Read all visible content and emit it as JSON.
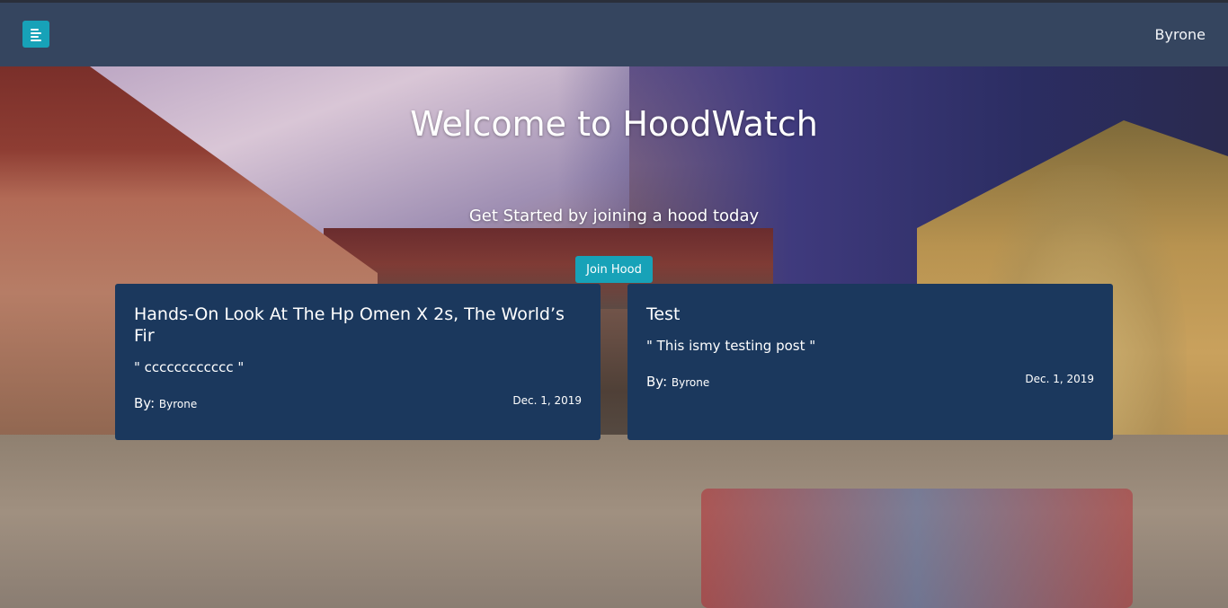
{
  "navbar": {
    "menu_icon": "menu-lines-icon",
    "user_name": "Byrone"
  },
  "hero": {
    "title": "Welcome to HoodWatch",
    "subtitle": "Get Started by joining a hood today",
    "join_button_label": "Join Hood"
  },
  "posts": [
    {
      "title": "Hands-On Look At The Hp Omen X 2s, The World’s Fir",
      "body": "\" cccccccccccc \"",
      "by_label": "By:",
      "author": "Byrone",
      "date": "Dec. 1, 2019"
    },
    {
      "title": "Test",
      "body": "\" This ismy testing post \"",
      "by_label": "By:",
      "author": "Byrone",
      "date": "Dec. 1, 2019"
    }
  ],
  "colors": {
    "navbar": "#35455f",
    "accent": "#17a2b8",
    "card": "#1b385d"
  }
}
